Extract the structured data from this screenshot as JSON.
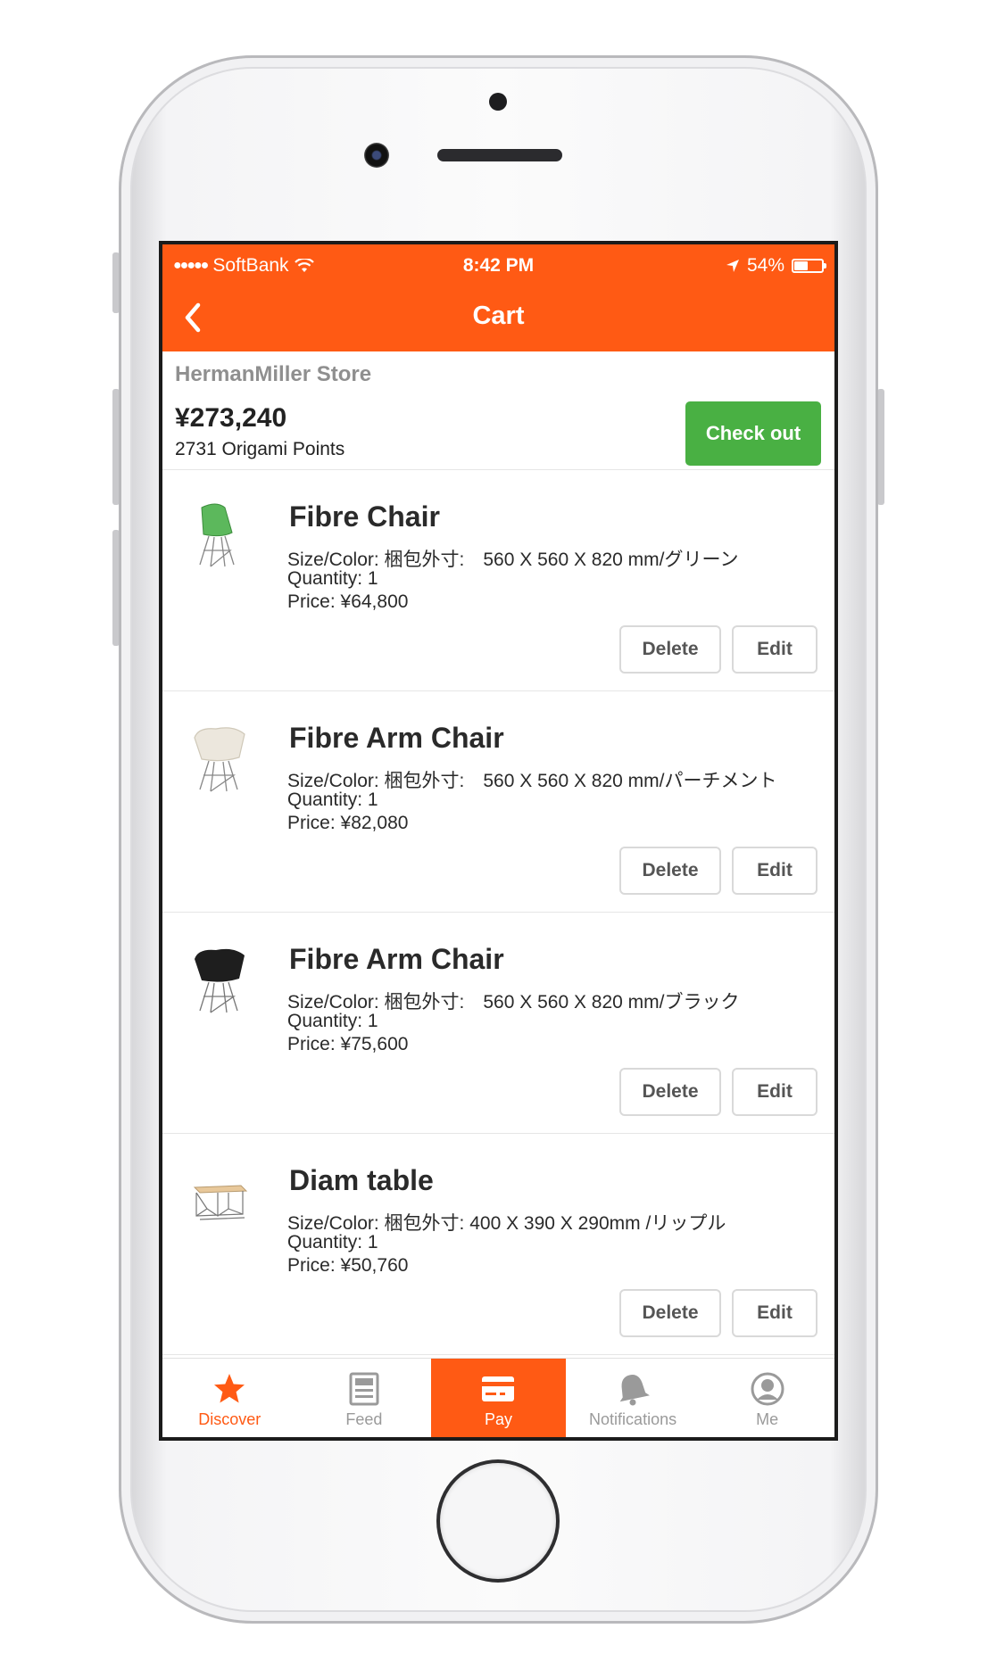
{
  "status_bar": {
    "carrier": "SoftBank",
    "signal_dots": "●●●●●",
    "time": "8:42 PM",
    "battery": "54%",
    "battery_level": 0.54
  },
  "nav": {
    "title": "Cart"
  },
  "store": {
    "name": "HermanMiller Store",
    "total": "¥273,240",
    "points": "2731 Origami Points",
    "checkout_label": "Check out"
  },
  "items": [
    {
      "name": "Fibre Chair",
      "size_color": "Size/Color: 梱包外寸:　560 X 560 X 820 mm/グリーン",
      "quantity": "Quantity: 1",
      "price": "Price: ¥64,800",
      "delete_label": "Delete",
      "edit_label": "Edit",
      "image_color": "#5cb85c"
    },
    {
      "name": "Fibre Arm Chair",
      "size_color": "Size/Color: 梱包外寸:　560 X 560 X 820 mm/パーチメント",
      "quantity": "Quantity: 1",
      "price": "Price: ¥82,080",
      "delete_label": "Delete",
      "edit_label": "Edit",
      "image_color": "#ece7dd"
    },
    {
      "name": "Fibre Arm Chair",
      "size_color": "Size/Color: 梱包外寸:　560 X 560 X 820 mm/ブラック",
      "quantity": "Quantity: 1",
      "price": "Price: ¥75,600",
      "delete_label": "Delete",
      "edit_label": "Edit",
      "image_color": "#1e1e1e"
    },
    {
      "name": "Diam table",
      "size_color": "Size/Color: 梱包外寸: 400 X 390 X 290mm /リップル",
      "quantity": "Quantity: 1",
      "price": "Price: ¥50,760",
      "delete_label": "Delete",
      "edit_label": "Edit",
      "image_color": "#e8c89a"
    }
  ],
  "tabs": [
    {
      "label": "Discover",
      "icon": "star-icon"
    },
    {
      "label": "Feed",
      "icon": "feed-icon"
    },
    {
      "label": "Pay",
      "icon": "credit-card-icon"
    },
    {
      "label": "Notifications",
      "icon": "bell-icon"
    },
    {
      "label": "Me",
      "icon": "user-icon"
    }
  ],
  "colors": {
    "brand_orange": "#ff5a14",
    "checkout_green": "#49b043"
  }
}
